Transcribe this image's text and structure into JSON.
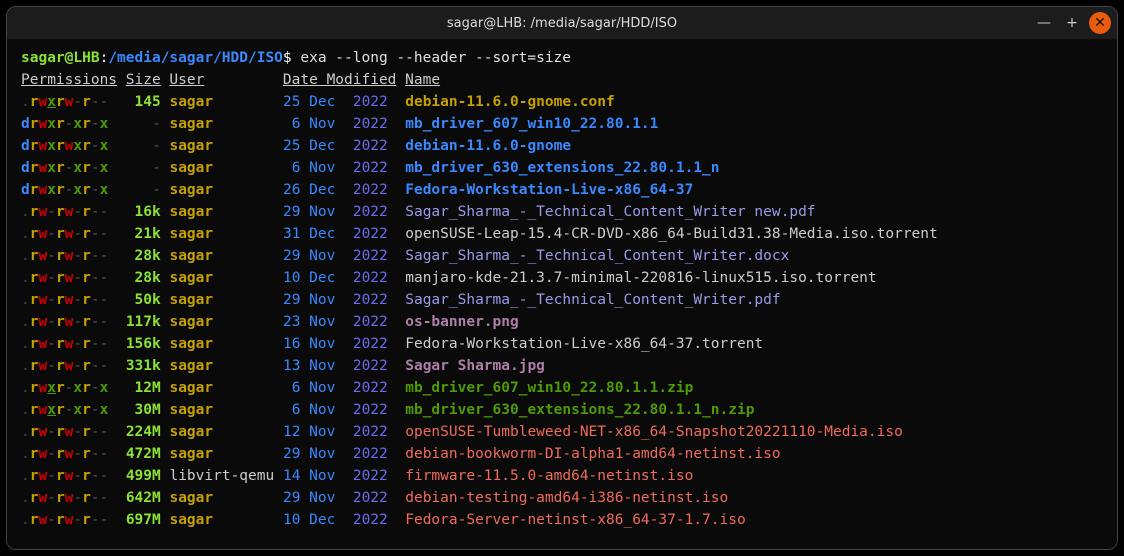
{
  "title": "sagar@LHB: /media/sagar/HDD/ISO",
  "prompt": {
    "user_host": "sagar@LHB",
    "colon": ":",
    "path": "/media/sagar/HDD/ISO",
    "symbol": "$"
  },
  "command": " exa --long --header --sort=size",
  "headers": {
    "permissions": "Permissions",
    "size": "Size",
    "user": "User",
    "date": "Date Modified",
    "name": "Name"
  },
  "rows": [
    {
      "perm": ".rwxrw-r--",
      "ux": true,
      "size": "145",
      "user": "sagar",
      "day": "25",
      "mon": "Dec",
      "year": "2022",
      "name": "debian-11.6.0-gnome.conf",
      "cls": "nm-txt"
    },
    {
      "perm": "drwxr-xr-x",
      "ux": false,
      "size": "-",
      "user": "sagar",
      "day": "6",
      "mon": "Nov",
      "year": "2022",
      "name": "mb_driver_607_win10_22.80.1.1",
      "cls": "nm-dir"
    },
    {
      "perm": "drwxrwxr-x",
      "ux": false,
      "size": "-",
      "user": "sagar",
      "day": "25",
      "mon": "Dec",
      "year": "2022",
      "name": "debian-11.6.0-gnome",
      "cls": "nm-dir"
    },
    {
      "perm": "drwxr-xr-x",
      "ux": false,
      "size": "-",
      "user": "sagar",
      "day": "6",
      "mon": "Nov",
      "year": "2022",
      "name": "mb_driver_630_extensions_22.80.1.1_n",
      "cls": "nm-dir"
    },
    {
      "perm": "drwxr-xr-x",
      "ux": false,
      "size": "-",
      "user": "sagar",
      "day": "26",
      "mon": "Dec",
      "year": "2022",
      "name": "Fedora-Workstation-Live-x86_64-37",
      "cls": "nm-dir"
    },
    {
      "perm": ".rw-rw-r--",
      "ux": false,
      "size": "16k",
      "user": "sagar",
      "day": "29",
      "mon": "Nov",
      "year": "2022",
      "name": "Sagar_Sharma_-_Technical_Content_Writer new.pdf",
      "cls": "nm-doc"
    },
    {
      "perm": ".rw-rw-r--",
      "ux": false,
      "size": "21k",
      "user": "sagar",
      "day": "31",
      "mon": "Dec",
      "year": "2022",
      "name": "openSUSE-Leap-15.4-CR-DVD-x86_64-Build31.38-Media.iso.torrent",
      "cls": "nm-plain"
    },
    {
      "perm": ".rw-rw-r--",
      "ux": false,
      "size": "28k",
      "user": "sagar",
      "day": "29",
      "mon": "Nov",
      "year": "2022",
      "name": "Sagar_Sharma_-_Technical_Content_Writer.docx",
      "cls": "nm-doc"
    },
    {
      "perm": ".rw-rw-r--",
      "ux": false,
      "size": "28k",
      "user": "sagar",
      "day": "10",
      "mon": "Dec",
      "year": "2022",
      "name": "manjaro-kde-21.3.7-minimal-220816-linux515.iso.torrent",
      "cls": "nm-plain"
    },
    {
      "perm": ".rw-rw-r--",
      "ux": false,
      "size": "50k",
      "user": "sagar",
      "day": "29",
      "mon": "Nov",
      "year": "2022",
      "name": "Sagar_Sharma_-_Technical_Content_Writer.pdf",
      "cls": "nm-doc"
    },
    {
      "perm": ".rw-rw-r--",
      "ux": false,
      "size": "117k",
      "user": "sagar",
      "day": "23",
      "mon": "Nov",
      "year": "2022",
      "name": "os-banner.png",
      "cls": "nm-img"
    },
    {
      "perm": ".rw-rw-r--",
      "ux": false,
      "size": "156k",
      "user": "sagar",
      "day": "16",
      "mon": "Nov",
      "year": "2022",
      "name": "Fedora-Workstation-Live-x86_64-37.torrent",
      "cls": "nm-plain"
    },
    {
      "perm": ".rw-rw-r--",
      "ux": false,
      "size": "331k",
      "user": "sagar",
      "day": "13",
      "mon": "Nov",
      "year": "2022",
      "name": "Sagar Sharma.jpg",
      "cls": "nm-img"
    },
    {
      "perm": ".rwxr-xr-x",
      "ux": true,
      "size": "12M",
      "user": "sagar",
      "day": "6",
      "mon": "Nov",
      "year": "2022",
      "name": "mb_driver_607_win10_22.80.1.1.zip",
      "cls": "nm-zip"
    },
    {
      "perm": ".rwxr-xr-x",
      "ux": true,
      "size": "30M",
      "user": "sagar",
      "day": "6",
      "mon": "Nov",
      "year": "2022",
      "name": "mb_driver_630_extensions_22.80.1.1_n.zip",
      "cls": "nm-zip"
    },
    {
      "perm": ".rw-rw-r--",
      "ux": false,
      "size": "224M",
      "user": "sagar",
      "day": "12",
      "mon": "Nov",
      "year": "2022",
      "name": "openSUSE-Tumbleweed-NET-x86_64-Snapshot20221110-Media.iso",
      "cls": "nm-red"
    },
    {
      "perm": ".rw-rw-r--",
      "ux": false,
      "size": "472M",
      "user": "sagar",
      "day": "29",
      "mon": "Nov",
      "year": "2022",
      "name": "debian-bookworm-DI-alpha1-amd64-netinst.iso",
      "cls": "nm-red"
    },
    {
      "perm": ".rw-rw-r--",
      "ux": false,
      "size": "499M",
      "user": "libvirt-qemu",
      "day": "14",
      "mon": "Nov",
      "year": "2022",
      "name": "firmware-11.5.0-amd64-netinst.iso",
      "cls": "nm-red"
    },
    {
      "perm": ".rw-rw-r--",
      "ux": false,
      "size": "642M",
      "user": "sagar",
      "day": "29",
      "mon": "Nov",
      "year": "2022",
      "name": "debian-testing-amd64-i386-netinst.iso",
      "cls": "nm-red"
    },
    {
      "perm": ".rw-rw-r--",
      "ux": false,
      "size": "697M",
      "user": "sagar",
      "day": "10",
      "mon": "Dec",
      "year": "2022",
      "name": "Fedora-Server-netinst-x86_64-37-1.7.iso",
      "cls": "nm-red"
    }
  ],
  "controls": {
    "min": "—",
    "max": "+",
    "close": "✕"
  }
}
